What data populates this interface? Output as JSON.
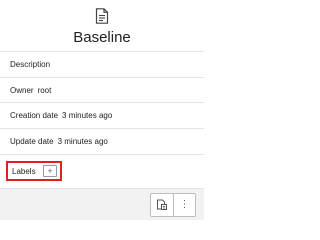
{
  "header": {
    "icon": "document-icon",
    "title": "Baseline"
  },
  "details": {
    "description_label": "Description",
    "owner_label": "Owner",
    "owner_value": "root",
    "creation_label": "Creation date",
    "creation_value": "3 minutes ago",
    "update_label": "Update date",
    "update_value": "3 minutes ago"
  },
  "labels": {
    "label": "Labels",
    "add_symbol": "+"
  },
  "footer": {
    "actions": [
      {
        "icon": "copy-document-icon"
      },
      {
        "icon": "kebab-menu-icon",
        "symbol": "⋮"
      }
    ]
  },
  "colors": {
    "highlight": "#e02020",
    "footer_bg": "#f2f2f2"
  }
}
